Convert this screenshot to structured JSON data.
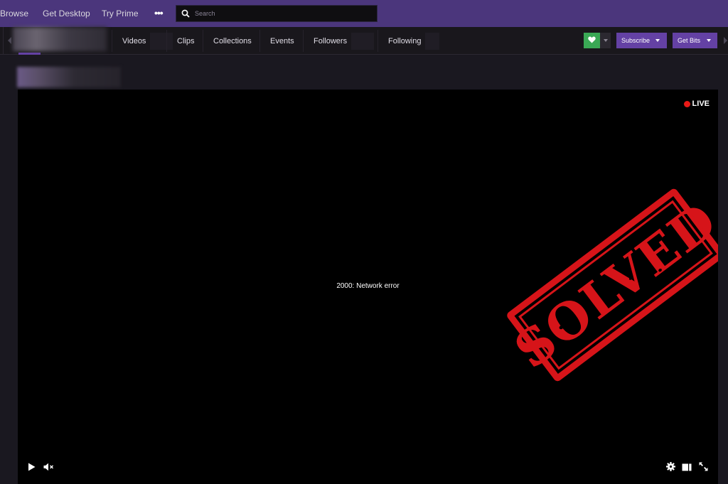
{
  "topnav": {
    "browse": "Browse",
    "get_desktop": "Get Desktop",
    "try_prime": "Try Prime",
    "more": "•••",
    "search_placeholder": "Search"
  },
  "channel_tabs": {
    "videos": "Videos",
    "clips": "Clips",
    "collections": "Collections",
    "events": "Events",
    "followers": "Followers",
    "following": "Following"
  },
  "actions": {
    "subscribe": "Subscribe",
    "get_bits": "Get Bits",
    "follow_icon": "heart-icon",
    "follow_color": "#3aa855",
    "accent": "#6441a4"
  },
  "player": {
    "live_label": "LIVE",
    "error_message": "2000: Network error",
    "live_color": "#e91916"
  },
  "stamp": {
    "text": "SOLVED",
    "color": "#e2161b"
  }
}
